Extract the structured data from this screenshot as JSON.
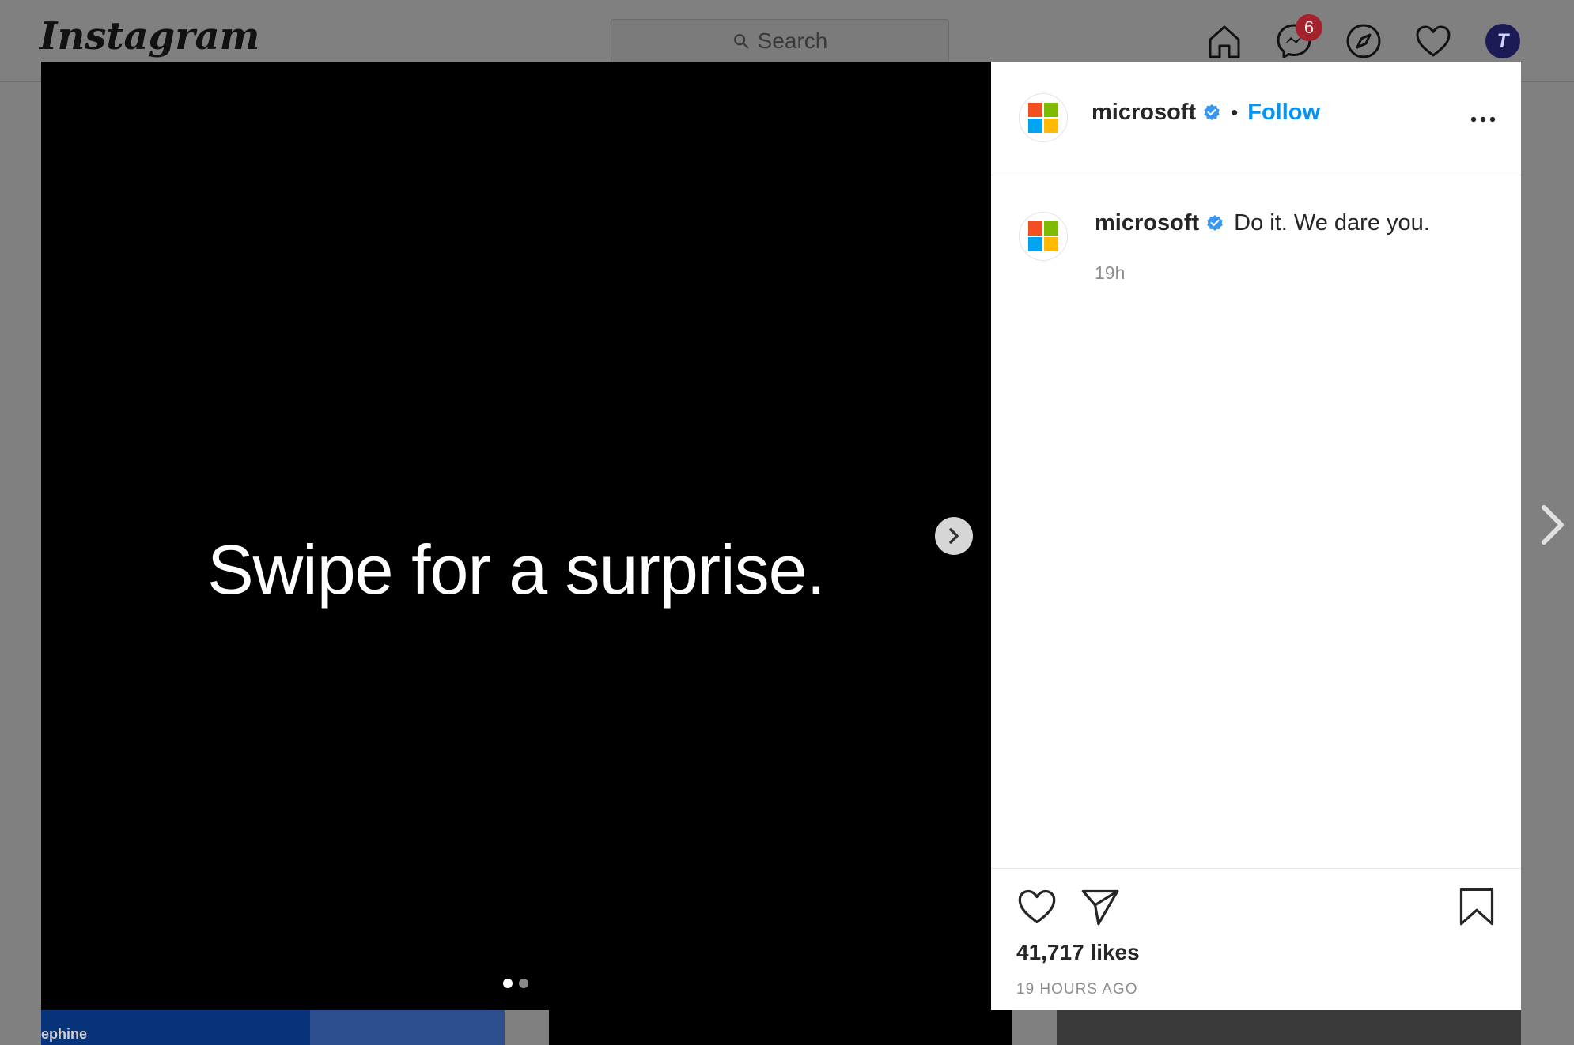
{
  "header": {
    "logo": "Instagram",
    "search_placeholder": "Search",
    "messages_badge": "6",
    "avatar_initial": "T"
  },
  "post": {
    "username": "microsoft",
    "follow_label": "Follow",
    "separator": "•",
    "slide_text": "Swipe for a surprise.",
    "slide_count": 2,
    "active_slide": 1,
    "caption": "Do it. We dare you.",
    "caption_time": "19h",
    "likes": "41,717 likes",
    "posted": "19 HOURS AGO"
  },
  "background": {
    "tile_caption": "ephine"
  },
  "colors": {
    "accent": "#0095f6",
    "ms_red": "#f25022",
    "ms_green": "#7fba00",
    "ms_blue": "#00a4ef",
    "ms_yellow": "#ffb900",
    "badge": "#ed4956"
  }
}
